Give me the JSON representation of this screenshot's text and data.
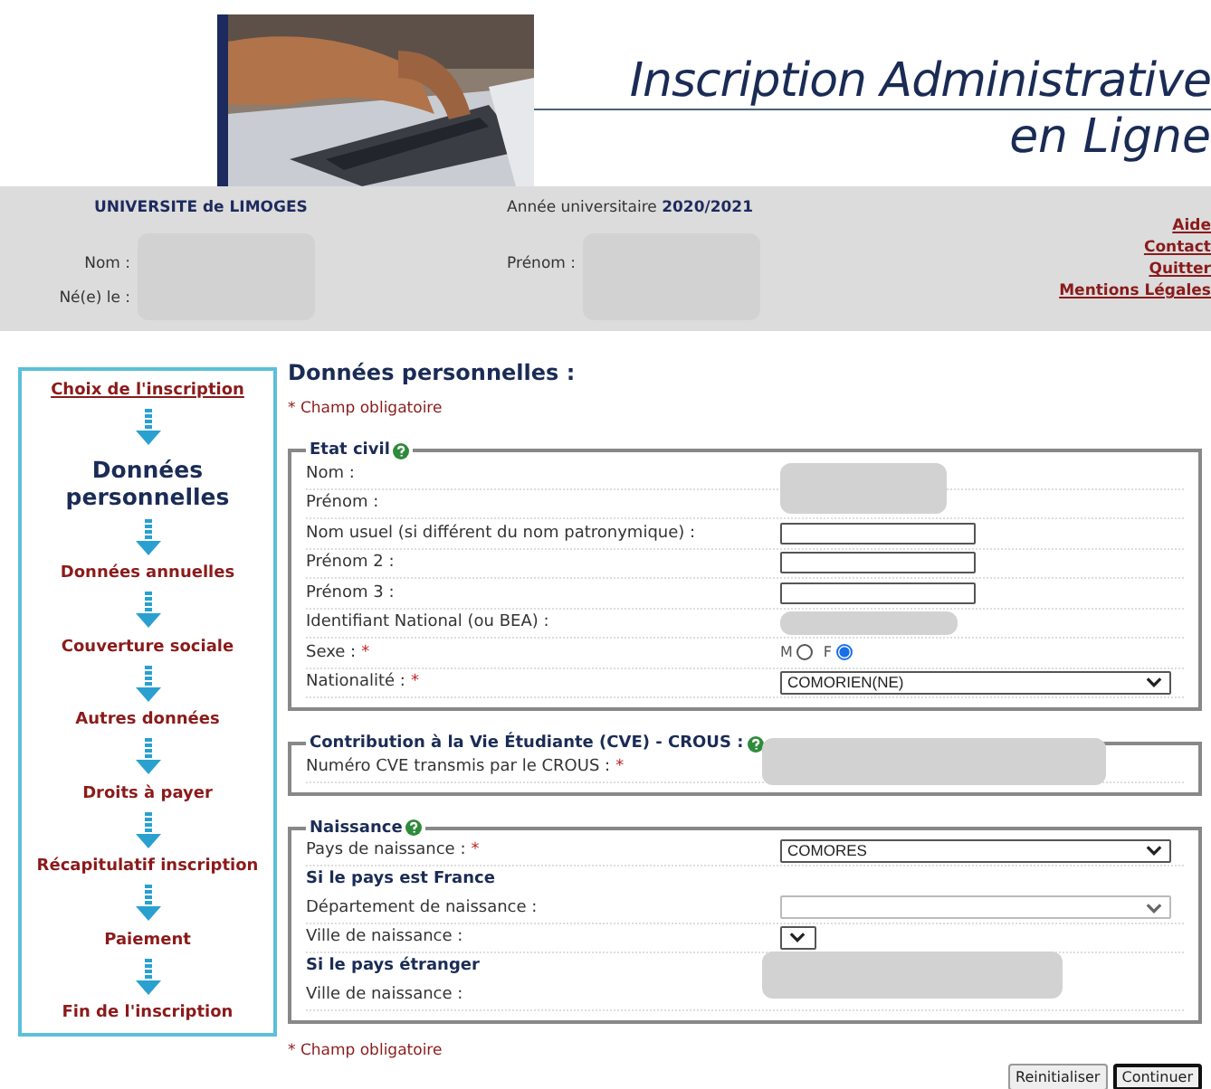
{
  "banner": {
    "title_line_1": "Inscription Administrative",
    "title_line_2": "en Ligne"
  },
  "info_bar": {
    "university": "UNIVERSITE de LIMOGES",
    "year_label": "Année universitaire",
    "year": "2020/2021",
    "nom_label": "Nom :",
    "birth_label": "Né(e) le :",
    "prenom_label": "Prénom :",
    "links": [
      "Aide",
      "Contact",
      "Quitter",
      "Mentions Légales"
    ]
  },
  "steps": [
    {
      "label": "Choix de l'inscription",
      "kind": "link"
    },
    {
      "label": "Données personnelles",
      "kind": "current"
    },
    {
      "label": "Données annuelles",
      "kind": "pending"
    },
    {
      "label": "Couverture sociale",
      "kind": "pending"
    },
    {
      "label": "Autres données",
      "kind": "pending"
    },
    {
      "label": "Droits à payer",
      "kind": "pending"
    },
    {
      "label": "Récapitulatif inscription",
      "kind": "pending"
    },
    {
      "label": "Paiement",
      "kind": "pending"
    },
    {
      "label": "Fin de l'inscription",
      "kind": "pending"
    }
  ],
  "page_title": "Données personnelles :",
  "required_note": "* Champ obligatoire",
  "sections": [
    {
      "title": "Etat civil",
      "rows": [
        {
          "kind": "readonly",
          "label": "Nom :"
        },
        {
          "kind": "readonly_cont",
          "label": "Prénom :"
        },
        {
          "kind": "text",
          "label": "Nom usuel (si différent du nom patronymique) :"
        },
        {
          "kind": "text",
          "label": "Prénom 2 :"
        },
        {
          "kind": "text",
          "label": "Prénom 3 :"
        },
        {
          "kind": "readonly_short",
          "label": "Identifiant National (ou BEA) :"
        },
        {
          "kind": "radio",
          "label": "Sexe :",
          "required_mark": "*",
          "options": [
            {
              "label": "M",
              "selected": false
            },
            {
              "label": "F",
              "selected": true
            }
          ]
        },
        {
          "kind": "select",
          "label": "Nationalité :",
          "required_mark": "*",
          "value": "COMORIEN(NE)"
        }
      ]
    },
    {
      "title": "Contribution à la Vie Étudiante (CVE) - CROUS :",
      "rows": [
        {
          "kind": "readonly_wide",
          "label": "Numéro CVE transmis par le CROUS :",
          "required_mark": "*"
        }
      ]
    },
    {
      "title": "Naissance",
      "rows": [
        {
          "kind": "select",
          "label": "Pays de naissance :",
          "required_mark": "*",
          "value": "COMORES"
        },
        {
          "kind": "heading",
          "label": "Si le pays est France"
        },
        {
          "kind": "select",
          "label": "Département de naissance :",
          "disabled": true
        },
        {
          "kind": "small_select",
          "label": "Ville de naissance :"
        },
        {
          "kind": "heading",
          "label": "Si le pays étranger"
        },
        {
          "kind": "readonly_wide_up",
          "label": "Ville de naissance :"
        }
      ]
    }
  ],
  "footer_note": "* Champ obligatoire",
  "buttons": [
    {
      "label": "Reinitialiser",
      "default": false
    },
    {
      "label": "Continuer",
      "default": true
    }
  ]
}
